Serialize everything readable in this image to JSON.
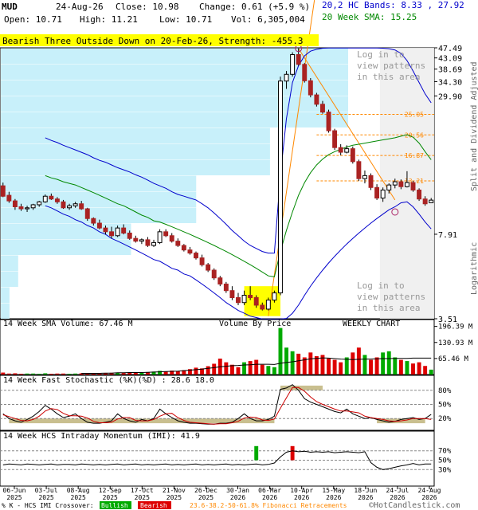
{
  "header": {
    "ticker": "MUD",
    "date": "24-Aug-26",
    "close_label": "Close: 10.98",
    "change_label": "Change: 0.61 (+5.9 %)",
    "open_label": "Open: 10.71",
    "high_label": "High: 11.21",
    "low_label": "Low: 10.71",
    "vol_label": "Vol: 6,305,004",
    "hc_bands_label": "20,2 HC Bands: 8.33 , 27.92",
    "sma_label": "20 Week SMA: 15.25",
    "pattern_banner": "Bearish Three Outside Down on 20-Feb-26, Strength: -455.3",
    "login_text": [
      "Log in to",
      "view patterns",
      "in this area"
    ],
    "volume_by_price_label": "Volume By Price",
    "chart_kind_label": "WEEKLY CHART",
    "right_side_labels": [
      "Split and Dividend Adjusted",
      "Logarithmic"
    ]
  },
  "colors": {
    "accent_blue": "#0000cc",
    "sma_green": "#008800",
    "banner_yellow": "#ffff00",
    "vbp_cyan": "#c8f0fa",
    "candle_down": "#aa2222",
    "vol_up": "#00aa00",
    "vol_down": "#dd0000",
    "fib_orange": "#ff8800"
  },
  "chart_data": [
    {
      "type": "line",
      "name_panel": "price",
      "y_scale": "log",
      "ylim": [
        3.51,
        47.49
      ],
      "y_ticks": [
        "47.49",
        "43.09",
        "38.69",
        "34.30",
        "29.90",
        "7.91",
        "3.51"
      ],
      "fib_levels": [
        "25.05",
        "20.56",
        "16.87",
        "13.21"
      ],
      "x_tick_labels": [
        "06-Jun\n2025",
        "03-Jul\n2025",
        "08-Aug\n2025",
        "12-Sep\n2025",
        "17-Oct\n2025",
        "21-Nov\n2025",
        "26-Dec\n2025",
        "30-Jan\n2026",
        "06-Mar\n2026",
        "10-Apr\n2026",
        "15-May\n2026",
        "18-Jun\n2026",
        "24-Jul\n2026",
        "24-Aug\n2026"
      ],
      "candles": [
        {
          "o": 12.6,
          "h": 13.0,
          "l": 11.3,
          "c": 11.4
        },
        {
          "o": 11.5,
          "h": 11.9,
          "l": 10.7,
          "c": 10.9
        },
        {
          "o": 10.9,
          "h": 11.1,
          "l": 10.0,
          "c": 10.3
        },
        {
          "o": 10.3,
          "h": 10.6,
          "l": 9.9,
          "c": 10.1
        },
        {
          "o": 10.1,
          "h": 10.4,
          "l": 9.8,
          "c": 10.2
        },
        {
          "o": 10.2,
          "h": 10.6,
          "l": 10.0,
          "c": 10.5
        },
        {
          "o": 10.5,
          "h": 10.9,
          "l": 10.3,
          "c": 10.8
        },
        {
          "o": 10.8,
          "h": 11.6,
          "l": 10.7,
          "c": 11.4
        },
        {
          "o": 11.4,
          "h": 11.7,
          "l": 11.0,
          "c": 11.1
        },
        {
          "o": 11.1,
          "h": 11.3,
          "l": 10.6,
          "c": 10.8
        },
        {
          "o": 10.8,
          "h": 11.0,
          "l": 10.1,
          "c": 10.2
        },
        {
          "o": 10.2,
          "h": 10.6,
          "l": 10.0,
          "c": 10.4
        },
        {
          "o": 10.4,
          "h": 10.8,
          "l": 10.2,
          "c": 10.6
        },
        {
          "o": 10.6,
          "h": 10.9,
          "l": 10.0,
          "c": 10.1
        },
        {
          "o": 10.1,
          "h": 10.2,
          "l": 9.0,
          "c": 9.2
        },
        {
          "o": 9.2,
          "h": 9.3,
          "l": 8.6,
          "c": 8.8
        },
        {
          "o": 8.8,
          "h": 9.1,
          "l": 8.3,
          "c": 8.4
        },
        {
          "o": 8.4,
          "h": 8.6,
          "l": 7.9,
          "c": 8.1
        },
        {
          "o": 8.1,
          "h": 8.5,
          "l": 7.6,
          "c": 7.8
        },
        {
          "o": 7.8,
          "h": 8.6,
          "l": 7.7,
          "c": 8.4
        },
        {
          "o": 8.4,
          "h": 8.7,
          "l": 7.9,
          "c": 8.0
        },
        {
          "o": 8.0,
          "h": 8.2,
          "l": 7.5,
          "c": 7.6
        },
        {
          "o": 7.6,
          "h": 7.8,
          "l": 7.3,
          "c": 7.4
        },
        {
          "o": 7.4,
          "h": 7.6,
          "l": 7.2,
          "c": 7.5
        },
        {
          "o": 7.5,
          "h": 7.7,
          "l": 7.0,
          "c": 7.1
        },
        {
          "o": 7.1,
          "h": 7.5,
          "l": 7.0,
          "c": 7.3
        },
        {
          "o": 7.3,
          "h": 8.3,
          "l": 7.2,
          "c": 8.1
        },
        {
          "o": 8.1,
          "h": 8.3,
          "l": 7.7,
          "c": 7.8
        },
        {
          "o": 7.8,
          "h": 8.0,
          "l": 7.3,
          "c": 7.4
        },
        {
          "o": 7.4,
          "h": 7.6,
          "l": 7.0,
          "c": 7.1
        },
        {
          "o": 7.1,
          "h": 7.2,
          "l": 6.7,
          "c": 6.8
        },
        {
          "o": 6.8,
          "h": 7.0,
          "l": 6.5,
          "c": 6.6
        },
        {
          "o": 6.6,
          "h": 6.7,
          "l": 6.2,
          "c": 6.3
        },
        {
          "o": 6.3,
          "h": 6.5,
          "l": 5.8,
          "c": 5.9
        },
        {
          "o": 5.9,
          "h": 6.0,
          "l": 5.5,
          "c": 5.6
        },
        {
          "o": 5.6,
          "h": 5.7,
          "l": 5.1,
          "c": 5.2
        },
        {
          "o": 5.2,
          "h": 5.3,
          "l": 4.8,
          "c": 4.9
        },
        {
          "o": 4.9,
          "h": 5.0,
          "l": 4.5,
          "c": 4.6
        },
        {
          "o": 4.6,
          "h": 4.8,
          "l": 4.2,
          "c": 4.3
        },
        {
          "o": 4.3,
          "h": 4.5,
          "l": 4.0,
          "c": 4.1
        },
        {
          "o": 4.1,
          "h": 4.6,
          "l": 4.0,
          "c": 4.4
        },
        {
          "o": 4.4,
          "h": 4.8,
          "l": 4.2,
          "c": 4.3
        },
        {
          "o": 4.3,
          "h": 4.4,
          "l": 3.9,
          "c": 4.0
        },
        {
          "o": 4.0,
          "h": 4.1,
          "l": 3.8,
          "c": 3.85
        },
        {
          "o": 3.85,
          "h": 4.3,
          "l": 3.8,
          "c": 4.2
        },
        {
          "o": 4.2,
          "h": 4.6,
          "l": 4.1,
          "c": 4.5
        },
        {
          "o": 4.5,
          "h": 36.0,
          "l": 4.4,
          "c": 34.5
        },
        {
          "o": 34.5,
          "h": 38.0,
          "l": 32.0,
          "c": 36.8
        },
        {
          "o": 36.8,
          "h": 45.5,
          "l": 36.0,
          "c": 44.5
        },
        {
          "o": 44.5,
          "h": 47.2,
          "l": 40.0,
          "c": 40.5
        },
        {
          "o": 40.5,
          "h": 41.0,
          "l": 34.0,
          "c": 34.6
        },
        {
          "o": 34.6,
          "h": 35.5,
          "l": 29.5,
          "c": 30.2
        },
        {
          "o": 30.2,
          "h": 30.8,
          "l": 27.0,
          "c": 27.6
        },
        {
          "o": 27.6,
          "h": 28.5,
          "l": 25.2,
          "c": 25.6
        },
        {
          "o": 25.6,
          "h": 26.2,
          "l": 21.0,
          "c": 21.4
        },
        {
          "o": 21.4,
          "h": 21.8,
          "l": 17.8,
          "c": 18.2
        },
        {
          "o": 18.2,
          "h": 18.8,
          "l": 16.9,
          "c": 17.4
        },
        {
          "o": 17.4,
          "h": 18.6,
          "l": 17.2,
          "c": 18.0
        },
        {
          "o": 18.0,
          "h": 18.4,
          "l": 15.6,
          "c": 15.9
        },
        {
          "o": 15.9,
          "h": 16.2,
          "l": 13.2,
          "c": 13.5
        },
        {
          "o": 13.5,
          "h": 14.6,
          "l": 12.9,
          "c": 13.9
        },
        {
          "o": 13.9,
          "h": 14.2,
          "l": 12.1,
          "c": 12.4
        },
        {
          "o": 12.4,
          "h": 12.8,
          "l": 11.0,
          "c": 11.2
        },
        {
          "o": 11.2,
          "h": 12.4,
          "l": 10.8,
          "c": 12.1
        },
        {
          "o": 12.1,
          "h": 12.9,
          "l": 11.7,
          "c": 12.7
        },
        {
          "o": 12.7,
          "h": 13.5,
          "l": 12.3,
          "c": 13.1
        },
        {
          "o": 13.1,
          "h": 13.4,
          "l": 12.2,
          "c": 12.5
        },
        {
          "o": 12.5,
          "h": 14.5,
          "l": 12.4,
          "c": 13.0
        },
        {
          "o": 13.0,
          "h": 13.2,
          "l": 11.9,
          "c": 12.1
        },
        {
          "o": 12.1,
          "h": 12.3,
          "l": 10.9,
          "c": 11.1
        },
        {
          "o": 11.1,
          "h": 11.4,
          "l": 10.4,
          "c": 10.6
        },
        {
          "o": 10.71,
          "h": 11.21,
          "l": 10.71,
          "c": 10.98
        }
      ],
      "sma20": [
        null,
        null,
        null,
        null,
        null,
        null,
        null,
        13.9,
        13.6,
        13.4,
        13.1,
        12.9,
        12.7,
        12.4,
        12.1,
        11.8,
        11.5,
        11.2,
        10.9,
        10.6,
        10.4,
        10.1,
        9.8,
        9.5,
        9.3,
        9.0,
        8.9,
        8.7,
        8.5,
        8.3,
        8.1,
        7.9,
        7.7,
        7.5,
        7.3,
        7.1,
        6.9,
        6.7,
        6.5,
        6.3,
        6.1,
        5.9,
        5.7,
        5.5,
        5.3,
        5.25,
        6.7,
        8.2,
        9.8,
        11.5,
        13.0,
        14.3,
        15.4,
        16.3,
        17.0,
        17.5,
        17.9,
        18.3,
        18.6,
        18.8,
        19.0,
        19.2,
        19.4,
        19.6,
        19.8,
        20.0,
        20.3,
        20.6,
        20.1,
        19.0,
        17.5,
        16.2
      ],
      "hc_upper": [
        null,
        null,
        null,
        null,
        null,
        null,
        null,
        20.0,
        19.5,
        19.1,
        18.6,
        18.2,
        17.8,
        17.4,
        17.0,
        16.5,
        16.1,
        15.8,
        15.4,
        15.0,
        14.7,
        14.4,
        14.0,
        13.7,
        13.3,
        12.9,
        12.6,
        12.3,
        11.9,
        11.6,
        11.4,
        11.2,
        11.0,
        10.6,
        10.2,
        9.7,
        9.2,
        8.7,
        8.2,
        7.8,
        7.4,
        7.1,
        6.9,
        6.7,
        6.6,
        6.6,
        14.0,
        24.0,
        34.0,
        40.0,
        44.0,
        46.0,
        46.8,
        47.3,
        47.4,
        47.4,
        47.4,
        47.4,
        47.4,
        47.4,
        47.4,
        47.4,
        47.4,
        47.3,
        47.1,
        46.5,
        45.0,
        42.0,
        38.0,
        34.0,
        30.5,
        28.0
      ],
      "hc_lower": [
        null,
        null,
        null,
        null,
        null,
        null,
        null,
        10.4,
        10.2,
        9.9,
        9.6,
        9.4,
        9.1,
        8.9,
        8.6,
        8.4,
        8.1,
        7.9,
        7.6,
        7.4,
        7.2,
        7.0,
        6.8,
        6.6,
        6.4,
        6.2,
        6.1,
        5.9,
        5.7,
        5.6,
        5.4,
        5.3,
        5.1,
        4.9,
        4.7,
        4.5,
        4.3,
        4.1,
        3.95,
        3.8,
        3.7,
        3.6,
        3.55,
        3.5,
        3.5,
        3.5,
        3.5,
        3.52,
        3.7,
        4.0,
        4.4,
        4.8,
        5.2,
        5.6,
        6.0,
        6.4,
        6.8,
        7.2,
        7.6,
        8.0,
        8.4,
        8.8,
        9.2,
        9.6,
        10.0,
        10.3,
        10.7,
        10.8,
        10.3,
        9.6,
        8.9,
        8.33
      ],
      "vbp_widths": [
        0.02,
        0.02,
        0.04,
        0.04,
        0.3,
        0.3,
        0.45,
        0.45,
        0.45,
        0.62,
        0.62,
        0.62,
        0.8,
        0.8,
        0.8,
        0.8,
        0.8
      ],
      "marker_low_index": 44,
      "marker_high_index": 49,
      "marker_fib_low_index": 65
    },
    {
      "type": "bar",
      "name_panel": "volume",
      "title": "14 Week SMA Volume: 67.46 M",
      "y_ticks": [
        "196.39 M",
        "130.93 M",
        "65.46 M"
      ],
      "ylim": [
        0,
        205
      ],
      "values": [
        8,
        4,
        5,
        3,
        4,
        4,
        3,
        5,
        3,
        4,
        4,
        3,
        4,
        5,
        6,
        5,
        6,
        5,
        7,
        8,
        6,
        9,
        8,
        7,
        10,
        12,
        15,
        12,
        16,
        14,
        18,
        22,
        28,
        25,
        34,
        44,
        65,
        50,
        40,
        30,
        50,
        55,
        60,
        40,
        35,
        30,
        190,
        110,
        95,
        85,
        70,
        90,
        75,
        80,
        65,
        60,
        50,
        70,
        90,
        110,
        80,
        60,
        70,
        90,
        95,
        70,
        60,
        55,
        45,
        50,
        35,
        20
      ],
      "sma": [
        null,
        null,
        null,
        null,
        null,
        null,
        null,
        null,
        null,
        null,
        null,
        null,
        null,
        5,
        5,
        5,
        5,
        6,
        6,
        7,
        7,
        8,
        8,
        8,
        9,
        10,
        11,
        12,
        13,
        14,
        16,
        18,
        20,
        22,
        25,
        28,
        32,
        34,
        36,
        37,
        39,
        40,
        42,
        42,
        42,
        41,
        46,
        49,
        52,
        56,
        60,
        64,
        66,
        68,
        67,
        65,
        63,
        62,
        61,
        62,
        63,
        63,
        64,
        65,
        65,
        66,
        66,
        66,
        67,
        67,
        67,
        67
      ]
    },
    {
      "type": "line",
      "name_panel": "stochastic",
      "title": "14 Week Fast Stochastic (%K)(%D) : 28.6 18.0",
      "y_ticks": [
        "80%",
        "50%",
        "20%"
      ],
      "ylim": [
        0,
        100
      ],
      "k": [
        30,
        20,
        15,
        12,
        18,
        25,
        35,
        48,
        40,
        30,
        22,
        25,
        30,
        20,
        12,
        10,
        10,
        12,
        15,
        30,
        20,
        15,
        12,
        18,
        15,
        20,
        40,
        30,
        22,
        15,
        12,
        10,
        10,
        9,
        8,
        8,
        10,
        10,
        12,
        20,
        30,
        20,
        15,
        15,
        18,
        25,
        82,
        85,
        92,
        80,
        62,
        55,
        50,
        45,
        40,
        35,
        32,
        40,
        30,
        25,
        20,
        22,
        18,
        15,
        12,
        14,
        18,
        20,
        22,
        18,
        20,
        28.6
      ],
      "d": [
        28,
        24,
        20,
        16,
        15,
        18,
        25,
        36,
        41,
        39,
        31,
        26,
        26,
        25,
        21,
        14,
        11,
        11,
        12,
        19,
        22,
        22,
        16,
        15,
        15,
        18,
        25,
        30,
        31,
        22,
        16,
        12,
        11,
        10,
        9,
        8,
        9,
        9,
        11,
        14,
        21,
        23,
        22,
        17,
        16,
        19,
        42,
        64,
        86,
        86,
        78,
        66,
        56,
        50,
        45,
        40,
        36,
        36,
        34,
        32,
        25,
        22,
        20,
        18,
        15,
        14,
        15,
        17,
        20,
        20,
        20,
        18.0
      ]
    },
    {
      "type": "bar",
      "name_panel": "imi",
      "title": "14 Week HCS Intraday Momentum (IMI): 41.9",
      "y_ticks": [
        "70%",
        "50%",
        "30%"
      ],
      "ylim": [
        0,
        100
      ],
      "values": [
        40,
        42,
        41,
        40,
        42,
        41,
        40,
        41,
        42,
        40,
        41,
        41,
        40,
        42,
        41,
        40,
        41,
        40,
        41,
        42,
        40,
        41,
        42,
        40,
        41,
        40,
        41,
        42,
        40,
        41,
        40,
        41,
        42,
        40,
        41,
        40,
        41,
        42,
        40,
        41,
        40,
        41,
        42,
        40,
        41,
        44,
        57,
        67,
        70,
        68,
        69,
        67,
        68,
        67,
        68,
        66,
        67,
        68,
        67,
        66,
        68,
        45,
        35,
        30,
        32,
        35,
        38,
        40,
        43,
        40,
        42,
        41.9
      ],
      "crossover_bullish_index": 42,
      "crossover_bearish_index": 48,
      "legend": {
        "prefix": "% K - HCS IMI Crossover:",
        "bullish": "Bullish",
        "bearish": "Bearish",
        "fib": "23.6-38.2-50-61.8% Fibonacci Retracements"
      },
      "copyright": "©HotCandlestick.com"
    }
  ]
}
